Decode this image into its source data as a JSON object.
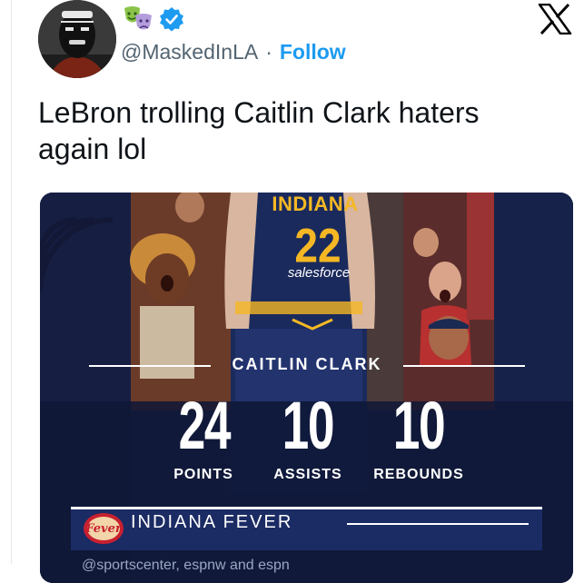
{
  "colors": {
    "accent": "#1d9bf0",
    "handle": "#536471",
    "text": "#0f1419",
    "fever_gold": "#f5b824",
    "fever_navy": "#17224a"
  },
  "header": {
    "handle": "@MaskedInLA",
    "separator": "·",
    "follow_label": "Follow",
    "icons": [
      "avatar",
      "masks-emoji-icon",
      "verified-badge-icon",
      "x-logo-icon"
    ]
  },
  "tweet": {
    "text": "LeBron trolling Caitlin Clark haters again lol"
  },
  "media": {
    "jersey": {
      "team": "INDIANA",
      "number": "22",
      "sponsor": "salesforce"
    },
    "player_name": "CAITLIN CLARK",
    "stats": [
      {
        "value": "24",
        "label": "POINTS"
      },
      {
        "value": "10",
        "label": "ASSISTS"
      },
      {
        "value": "10",
        "label": "REBOUNDS"
      }
    ],
    "team_logo_text": "Fever",
    "team_name": "INDIANA FEVER",
    "credit": "@sportscenter, espnw and espn"
  }
}
